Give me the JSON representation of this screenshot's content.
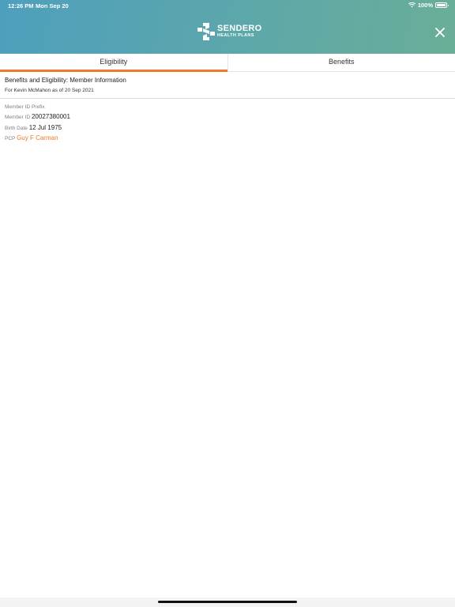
{
  "status_bar": {
    "time": "12:26 PM",
    "date": "Mon Sep 20",
    "battery": "100%",
    "icons": [
      "wifi-icon",
      "battery-icon"
    ]
  },
  "header": {
    "logo_name": "SENDERO",
    "logo_sub": "HEALTH PLANS",
    "close_icon": "close-icon",
    "colors": {
      "gradient_start": "#4e9fbd",
      "gradient_end": "#6aae98"
    }
  },
  "tabs": [
    {
      "label": "Eligibility",
      "active": true
    },
    {
      "label": "Benefits",
      "active": false
    }
  ],
  "accent_color": "#f07a27",
  "member": {
    "title": "Benefits and Eligibility: Member Information",
    "subtitle": "For Kevin McMahon as of 20 Sep 2021",
    "fields": [
      {
        "label": "Member ID Prefix",
        "value": ""
      },
      {
        "label": "Member ID",
        "value": "20027380001"
      },
      {
        "label": "Birth Date",
        "value": "12 Jul 1975"
      },
      {
        "label": "PCP",
        "value": "Guy F Carman"
      }
    ]
  }
}
